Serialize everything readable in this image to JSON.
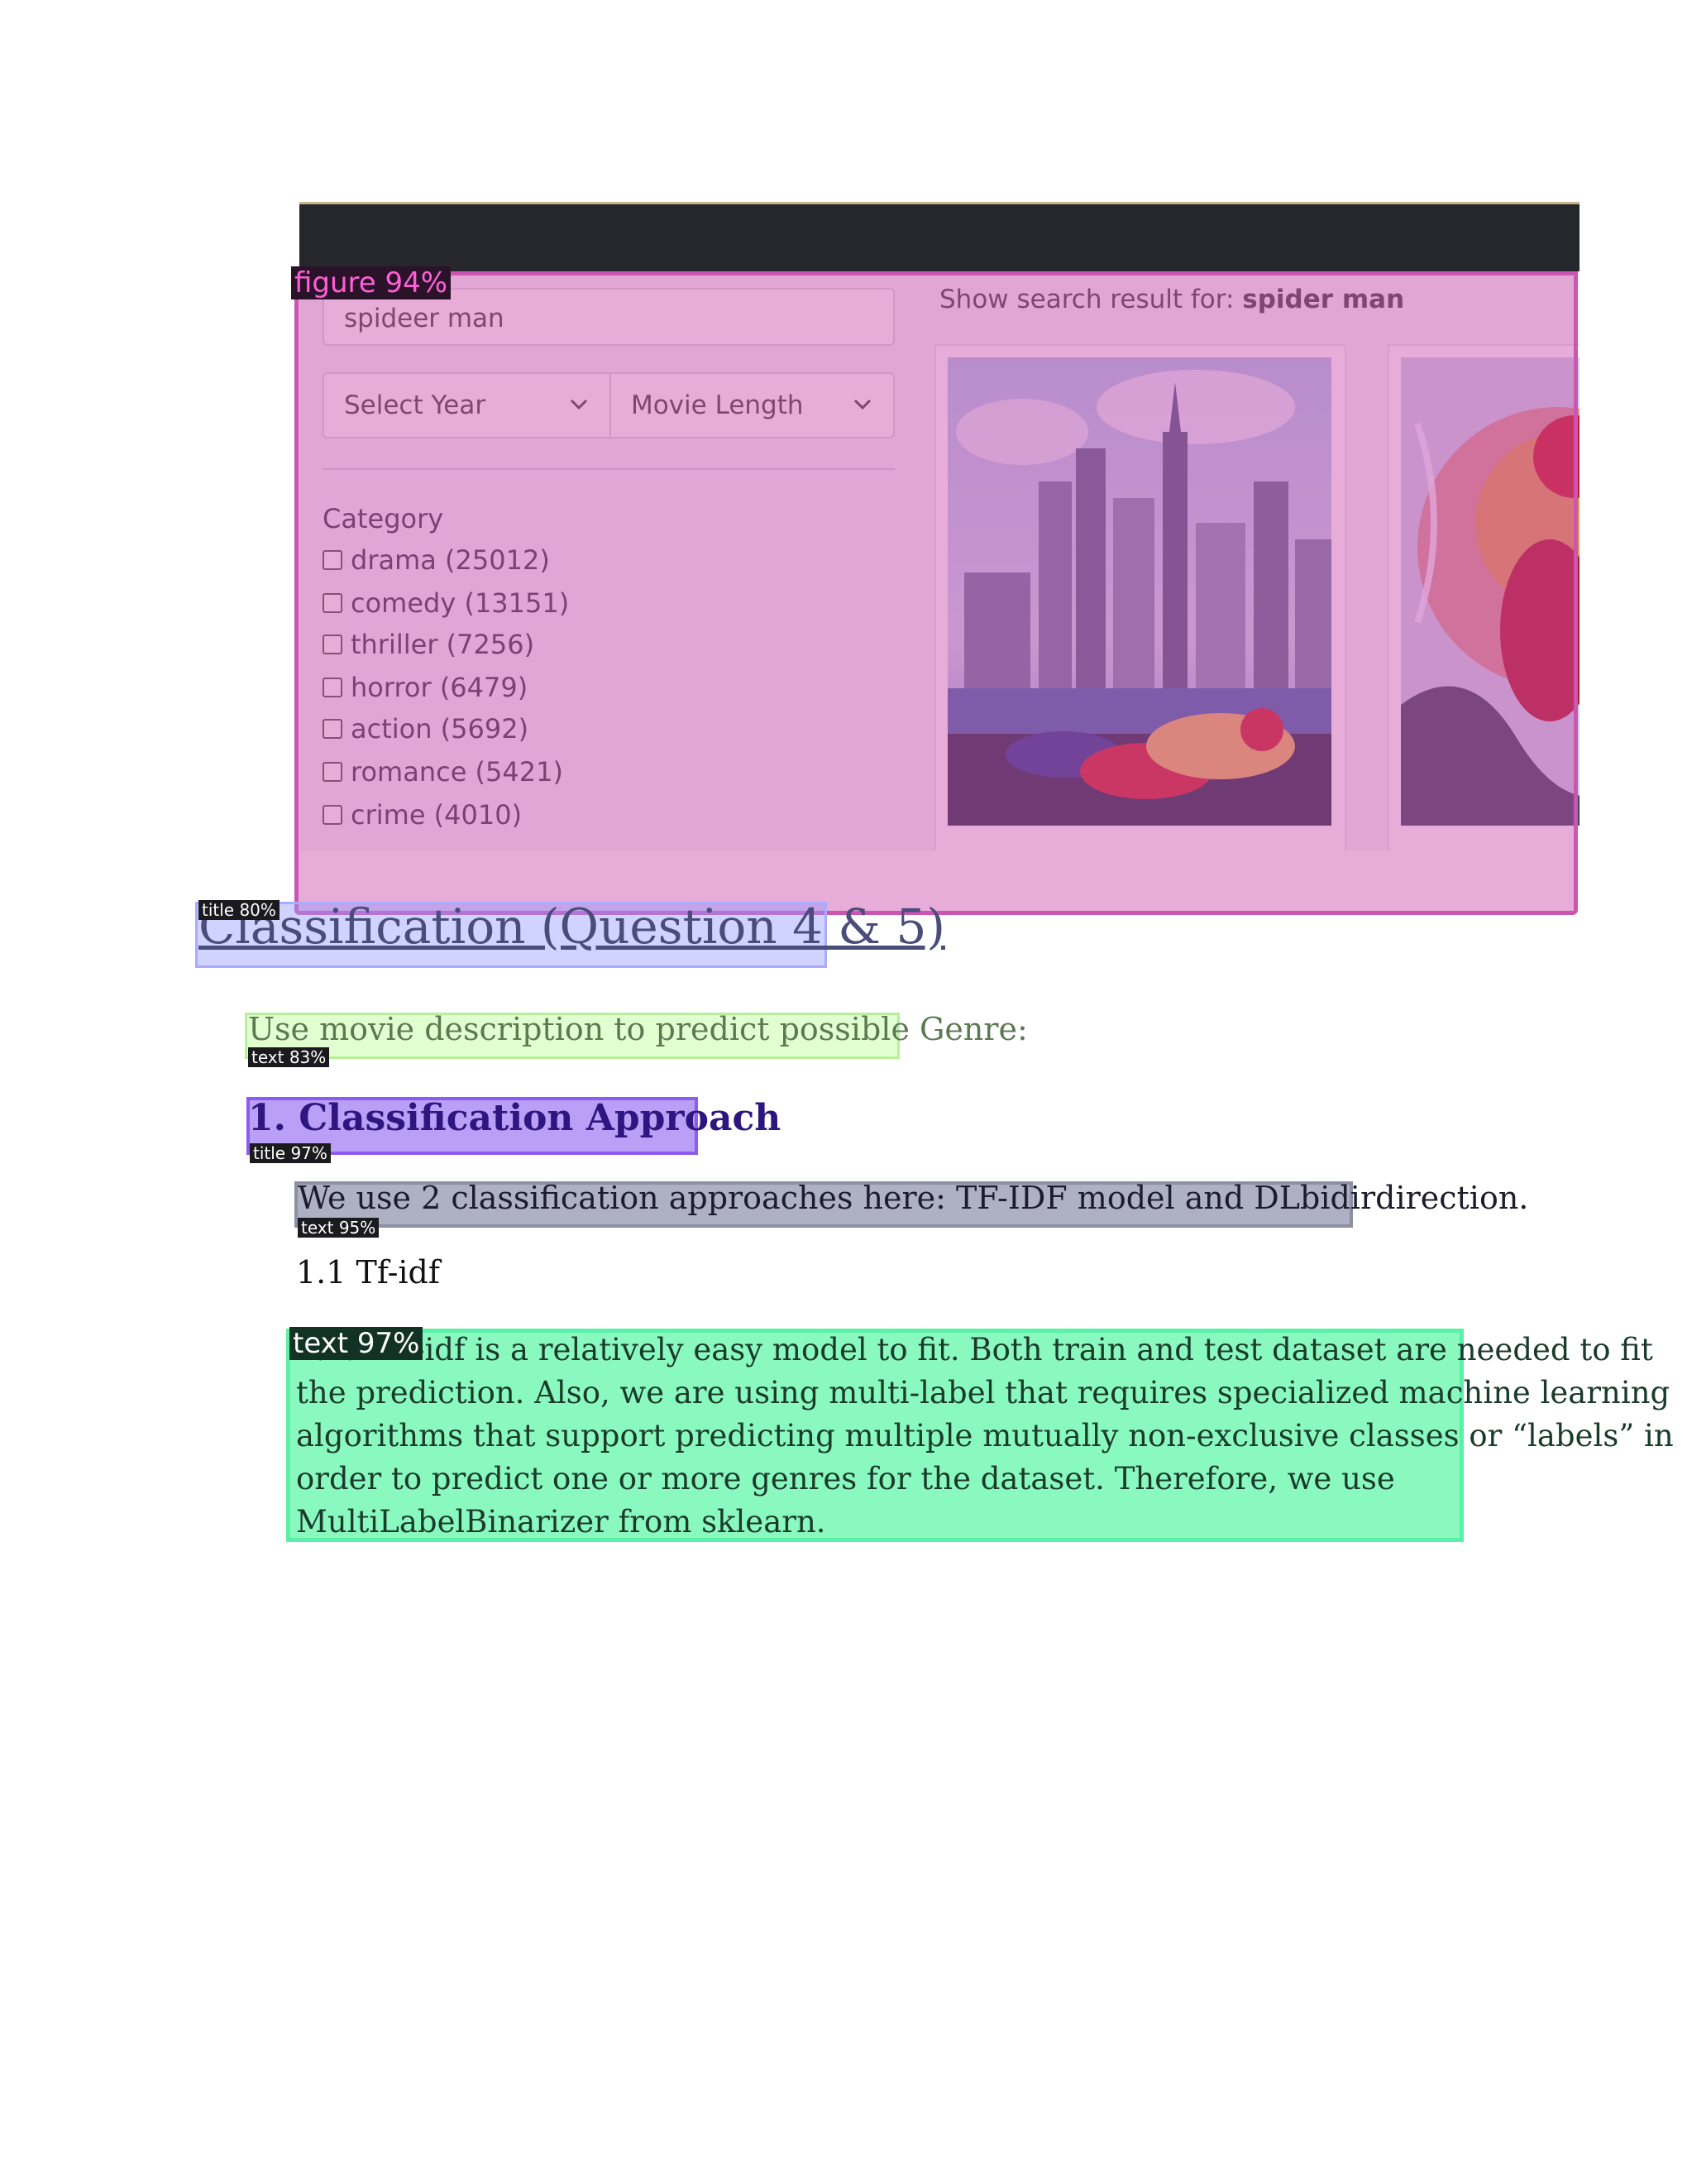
{
  "figure_tag": "figure 94%",
  "ui": {
    "search_value": "spideer man",
    "select_year": "Select Year",
    "movie_length": "Movie Length",
    "category_title": "Category",
    "categories": [
      "drama (25012)",
      "comedy (13151)",
      "thriller (7256)",
      "horror (6479)",
      "action (5692)",
      "romance (5421)",
      "crime (4010)"
    ],
    "result_prefix": "Show search result for:",
    "result_query": "spider man"
  },
  "section": {
    "tag": "title 80%",
    "title": "Classification (Question 4 & 5)"
  },
  "intro": {
    "tag": "text 83%",
    "text": "Use movie description to predict possible Genre:"
  },
  "heading1": {
    "tag": "title 97%",
    "text": "1.  Classification Approach"
  },
  "approach": {
    "tag": "text 95%",
    "text": "We use 2 classification approaches here: TF-IDF model and DLbidirdirection."
  },
  "subheading": "1.1 Tf-idf",
  "paragraph": {
    "tag": "text 97%",
    "lines": [
      "1.1.1 Tf-idf is a relatively easy model to fit. Both train and test dataset are needed to fit",
      "the prediction. Also, we are using multi-label that requires specialized machine learning",
      "algorithms that support predicting multiple mutually non-exclusive classes or “labels” in",
      "order to predict one or more genres for the dataset. Therefore, we use",
      "MultiLabelBinarizer from sklearn."
    ]
  }
}
